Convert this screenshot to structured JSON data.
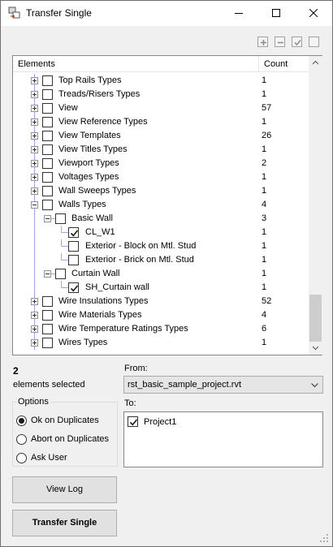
{
  "window": {
    "title": "Transfer Single"
  },
  "toolbar": {
    "icons": [
      "expand-all-icon",
      "collapse-all-icon",
      "check-all-icon",
      "uncheck-all-icon"
    ]
  },
  "tree": {
    "headers": {
      "elements": "Elements",
      "count": "Count"
    },
    "rows": [
      {
        "label": "Top Rails Types",
        "count": "1",
        "level": 0,
        "expander": "plus",
        "checked": false
      },
      {
        "label": "Treads/Risers Types",
        "count": "1",
        "level": 0,
        "expander": "plus",
        "checked": false
      },
      {
        "label": "View",
        "count": "57",
        "level": 0,
        "expander": "plus",
        "checked": false
      },
      {
        "label": "View Reference Types",
        "count": "1",
        "level": 0,
        "expander": "plus",
        "checked": false
      },
      {
        "label": "View Templates",
        "count": "26",
        "level": 0,
        "expander": "plus",
        "checked": false
      },
      {
        "label": "View Titles Types",
        "count": "1",
        "level": 0,
        "expander": "plus",
        "checked": false
      },
      {
        "label": "Viewport Types",
        "count": "2",
        "level": 0,
        "expander": "plus",
        "checked": false
      },
      {
        "label": "Voltages Types",
        "count": "1",
        "level": 0,
        "expander": "plus",
        "checked": false
      },
      {
        "label": "Wall Sweeps Types",
        "count": "1",
        "level": 0,
        "expander": "plus",
        "checked": false
      },
      {
        "label": "Walls Types",
        "count": "4",
        "level": 0,
        "expander": "minus",
        "checked": false
      },
      {
        "label": "Basic Wall",
        "count": "3",
        "level": 1,
        "expander": "minus",
        "checked": false
      },
      {
        "label": "CL_W1",
        "count": "1",
        "level": 2,
        "expander": "none",
        "checked": true
      },
      {
        "label": "Exterior - Block on Mtl. Stud",
        "count": "1",
        "level": 2,
        "expander": "none",
        "checked": false
      },
      {
        "label": "Exterior - Brick on Mtl. Stud",
        "count": "1",
        "level": 2,
        "expander": "none",
        "checked": false
      },
      {
        "label": "Curtain Wall",
        "count": "1",
        "level": 1,
        "expander": "minus",
        "checked": false
      },
      {
        "label": "SH_Curtain wall",
        "count": "1",
        "level": 2,
        "expander": "none",
        "checked": true
      },
      {
        "label": "Wire Insulations Types",
        "count": "52",
        "level": 0,
        "expander": "plus",
        "checked": false
      },
      {
        "label": "Wire Materials Types",
        "count": "4",
        "level": 0,
        "expander": "plus",
        "checked": false
      },
      {
        "label": "Wire Temperature Ratings Types",
        "count": "6",
        "level": 0,
        "expander": "plus",
        "checked": false
      },
      {
        "label": "Wires Types",
        "count": "1",
        "level": 0,
        "expander": "plus",
        "checked": false
      }
    ]
  },
  "selection": {
    "count": "2",
    "label": "elements selected"
  },
  "options": {
    "legend": "Options",
    "items": [
      {
        "label": "Ok on Duplicates",
        "selected": true
      },
      {
        "label": "Abort on Duplicates",
        "selected": false
      },
      {
        "label": "Ask User",
        "selected": false
      }
    ]
  },
  "buttons": {
    "view_log": "View Log",
    "transfer_single": "Transfer Single"
  },
  "from": {
    "label": "From:",
    "value": "rst_basic_sample_project.rvt"
  },
  "to": {
    "label": "To:",
    "items": [
      {
        "label": "Project1",
        "checked": true
      }
    ]
  },
  "colors": {
    "tree_line": "#a0a0ff",
    "check": "#1a1a1a",
    "scroll_thumb": "#cdcdcd"
  }
}
